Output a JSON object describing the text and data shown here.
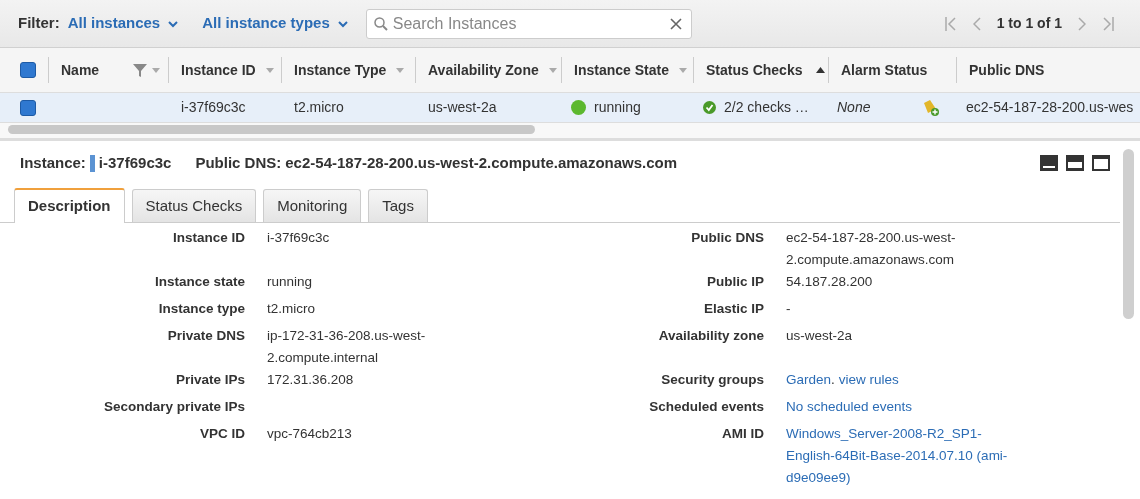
{
  "toolbar": {
    "filter_label": "Filter:",
    "filters": [
      "All instances",
      "All instance types"
    ],
    "search": {
      "placeholder": "Search Instances"
    },
    "pagination": "1 to 1 of 1"
  },
  "table": {
    "all_checked": true,
    "columns": [
      {
        "label": "Name",
        "sort_menu": true,
        "sorted_ascending": false,
        "filter": true
      },
      {
        "label": "Instance ID",
        "sort_menu": true,
        "sorted_ascending": false
      },
      {
        "label": "Instance Type",
        "sort_menu": true,
        "sorted_ascending": false
      },
      {
        "label": "Availability Zone",
        "sort_menu": true,
        "sorted_ascending": false
      },
      {
        "label": "Instance State",
        "sort_menu": true,
        "sorted_ascending": false
      },
      {
        "label": "Status Checks",
        "sort_menu": false,
        "sorted_ascending": true
      },
      {
        "label": "Alarm Status",
        "sort_menu": false,
        "sorted_ascending": false
      },
      {
        "label": "Public DNS",
        "sort_menu": false,
        "sorted_ascending": false
      }
    ],
    "rows": [
      {
        "checked": true,
        "selected": true,
        "instance_id": "i-37f69c3c",
        "instance_type": "t2.micro",
        "zone": "us-west-2a",
        "state": "running",
        "color": "#5cb82f",
        "status_checks": "2/2 checks …",
        "alarm_status": "None",
        "public_dns": "ec2-54-187-28-200.us-wes"
      }
    ]
  },
  "detail": {
    "instance_label": "Instance:",
    "instance_id": "i-37f69c3c",
    "dns_label": "Public DNS:",
    "dns": "ec2-54-187-28-200.us-west-2.compute.amazonaws.com",
    "tabs": [
      {
        "label": "Description",
        "selected": true
      },
      {
        "label": "Status Checks",
        "selected": false
      },
      {
        "label": "Monitoring",
        "selected": false
      },
      {
        "label": "Tags",
        "selected": false
      }
    ],
    "rows": [
      {
        "left": {
          "label": "Instance ID",
          "kind": "text",
          "value": "i-37f69c3c"
        },
        "right": {
          "label": "Public DNS",
          "kind": "text",
          "value": "ec2-54-187-28-200.us-west-2.compute.amazonaws.com"
        }
      },
      {
        "left": {
          "label": "Instance state",
          "kind": "text",
          "value": "running"
        },
        "right": {
          "label": "Public IP",
          "kind": "text",
          "value": "54.187.28.200"
        }
      },
      {
        "left": {
          "label": "Instance type",
          "kind": "text",
          "value": "t2.micro"
        },
        "right": {
          "label": "Elastic IP",
          "kind": "text",
          "value": "-"
        }
      },
      {
        "left": {
          "label": "Private DNS",
          "kind": "text",
          "value": "ip-172-31-36-208.us-west-2.compute.internal"
        },
        "right": {
          "label": "Availability zone",
          "kind": "text",
          "value": "us-west-2a"
        }
      },
      {
        "left": {
          "label": "Private IPs",
          "kind": "text",
          "value": "172.31.36.208"
        },
        "right": {
          "label": "Security groups",
          "kind": "links",
          "links": [
            "Garden",
            "view rules"
          ],
          "separator": "."
        }
      },
      {
        "left": {
          "label": "Secondary private IPs",
          "kind": "empty"
        },
        "right": {
          "label": "Scheduled events",
          "kind": "link",
          "value": "No scheduled events"
        }
      },
      {
        "left": {
          "label": "VPC ID",
          "kind": "text",
          "value": "vpc-764cb213"
        },
        "right": {
          "label": "AMI ID",
          "kind": "link",
          "value": "Windows_Server-2008-R2_SP1-English-64Bit-Base-2014.07.10 (ami-d9e09ee9)"
        }
      }
    ]
  }
}
